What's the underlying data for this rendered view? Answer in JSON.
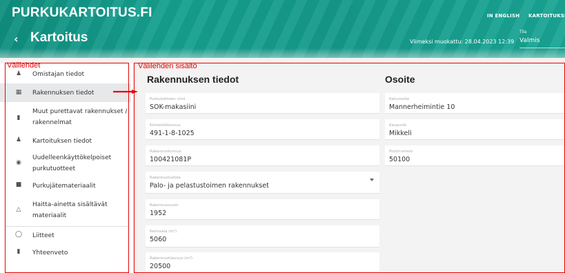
{
  "header": {
    "brand": "PURKUKARTOITUS.FI",
    "back_icon": "chevron-left-icon",
    "title": "Kartoitus",
    "nav_english": "IN ENGLISH",
    "nav_kartoitukset": "KARTOITUKSET",
    "last_modified": "Viimeksi muokattu: 28.04.2023 12:39",
    "status_label": "Tila",
    "status_value": "Valmis"
  },
  "annotations": {
    "tabs_label": "Välilehdet",
    "content_label": "Välilehden sisältö"
  },
  "sidebar": {
    "items": [
      {
        "label": "Omistajan tiedot",
        "icon": "person-icon"
      },
      {
        "label": "Rakennuksen tiedot",
        "icon": "building-icon"
      },
      {
        "label": "Muut purettavat rakennukset / rakennelmat",
        "icon": "document-icon"
      },
      {
        "label": "Kartoituksen tiedot",
        "icon": "person-question-icon"
      },
      {
        "label": "Uudelleenkäyttökelpoiset purkutuotteet",
        "icon": "recycle-icon"
      },
      {
        "label": "Purkujätemateriaalit",
        "icon": "trash-icon"
      },
      {
        "label": "Haitta-ainetta sisältävät materiaalit",
        "icon": "warning-icon"
      },
      {
        "label": "Liitteet",
        "icon": "attachment-icon"
      },
      {
        "label": "Yhteenveto",
        "icon": "summary-icon"
      }
    ]
  },
  "building": {
    "title": "Rakennuksen tiedot",
    "fields": [
      {
        "label": "Purkukohteen nimi",
        "value": "SOK-makasiini"
      },
      {
        "label": "Kiinteistötunnus",
        "value": "491-1-8-1025"
      },
      {
        "label": "Rakennustunnus",
        "value": "100421081P"
      },
      {
        "label": "Rakennusluokka",
        "value": "Palo- ja pelastustoimen rakennukset"
      },
      {
        "label": "Rakennusvuosi",
        "value": "1952"
      },
      {
        "label": "Kerrosala (m²)",
        "value": "5060"
      },
      {
        "label": "Rakennustilavuus (m³)",
        "value": "20500"
      }
    ]
  },
  "address": {
    "title": "Osoite",
    "fields": [
      {
        "label": "Katuosoite",
        "value": "Mannerheimintie 10"
      },
      {
        "label": "Kaupunki",
        "value": "Mikkeli"
      },
      {
        "label": "Postinumero",
        "value": "50100"
      }
    ]
  },
  "colors": {
    "header_teal": "#16a08f",
    "annotation_red": "#e60000"
  }
}
